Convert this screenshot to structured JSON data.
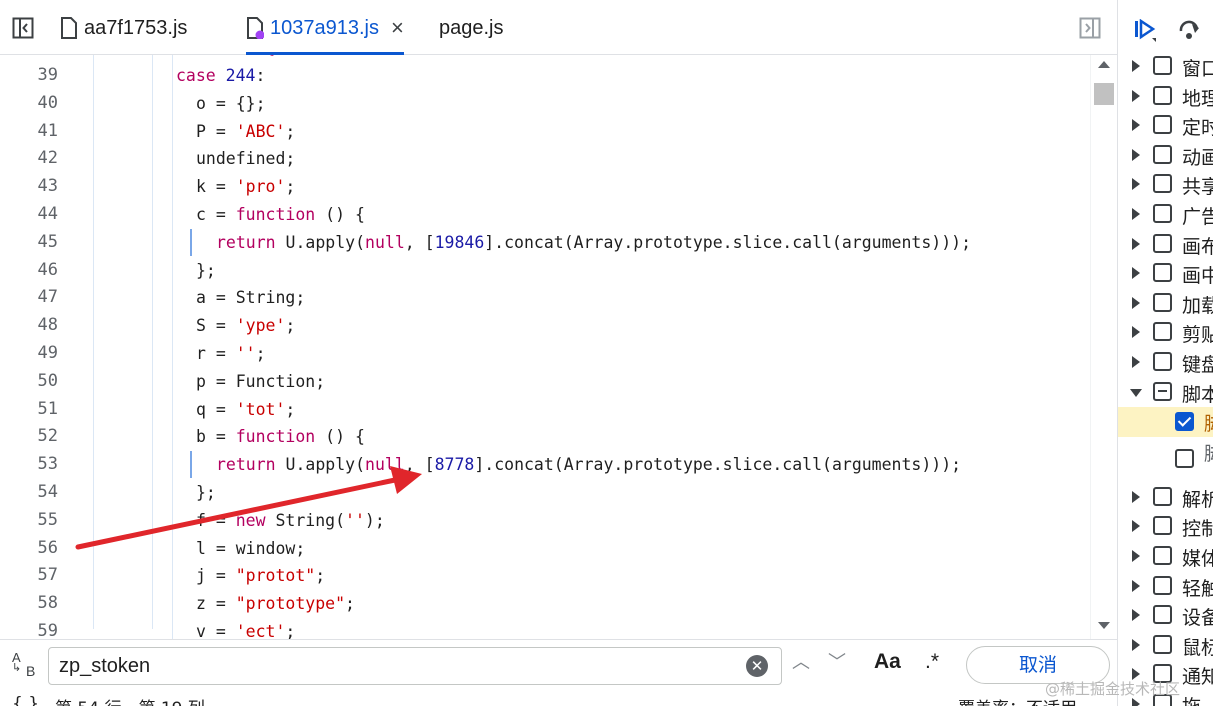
{
  "tabs": [
    {
      "label": "aa7f1753.js",
      "active": false,
      "modified": false
    },
    {
      "label": "1037a913.js",
      "active": true,
      "modified": true
    },
    {
      "label": "page.js",
      "active": false,
      "modified": false
    }
  ],
  "tab_close_glyph": "×",
  "code_top_partial": "switch (a) {",
  "code_lines": [
    {
      "n": "39",
      "indent": 1,
      "parts": [
        [
          "kw",
          "case "
        ],
        [
          "num",
          "244"
        ],
        [
          "",
          ":"
        ]
      ]
    },
    {
      "n": "40",
      "indent": 2,
      "parts": [
        [
          "",
          "o = {};"
        ]
      ]
    },
    {
      "n": "41",
      "indent": 2,
      "parts": [
        [
          "",
          "P = "
        ],
        [
          "str",
          "'ABC'"
        ],
        [
          "",
          ";"
        ]
      ]
    },
    {
      "n": "42",
      "indent": 2,
      "parts": [
        [
          "",
          "undefined;"
        ]
      ]
    },
    {
      "n": "43",
      "indent": 2,
      "parts": [
        [
          "",
          "k = "
        ],
        [
          "str",
          "'pro'"
        ],
        [
          "",
          ";"
        ]
      ]
    },
    {
      "n": "44",
      "indent": 2,
      "parts": [
        [
          "",
          "c = "
        ],
        [
          "kw",
          "function"
        ],
        [
          "",
          " () {"
        ]
      ]
    },
    {
      "n": "45",
      "indent": 3,
      "parts": [
        [
          "kw",
          "return"
        ],
        [
          "",
          " U.apply("
        ],
        [
          "kw",
          "null"
        ],
        [
          "",
          ", ["
        ],
        [
          "num",
          "19846"
        ],
        [
          "",
          "].concat(Array.prototype.slice.call(arguments)));"
        ]
      ]
    },
    {
      "n": "46",
      "indent": 2,
      "parts": [
        [
          "",
          "};"
        ]
      ]
    },
    {
      "n": "47",
      "indent": 2,
      "parts": [
        [
          "",
          "a = String;"
        ]
      ]
    },
    {
      "n": "48",
      "indent": 2,
      "parts": [
        [
          "",
          "S = "
        ],
        [
          "str",
          "'ype'"
        ],
        [
          "",
          ";"
        ]
      ]
    },
    {
      "n": "49",
      "indent": 2,
      "parts": [
        [
          "",
          "r = "
        ],
        [
          "str",
          "''"
        ],
        [
          "",
          ";"
        ]
      ]
    },
    {
      "n": "50",
      "indent": 2,
      "parts": [
        [
          "",
          "p = Function;"
        ]
      ]
    },
    {
      "n": "51",
      "indent": 2,
      "parts": [
        [
          "",
          "q = "
        ],
        [
          "str",
          "'tot'"
        ],
        [
          "",
          ";"
        ]
      ]
    },
    {
      "n": "52",
      "indent": 2,
      "parts": [
        [
          "",
          "b = "
        ],
        [
          "kw",
          "function"
        ],
        [
          "",
          " () {"
        ]
      ]
    },
    {
      "n": "53",
      "indent": 3,
      "parts": [
        [
          "kw",
          "return"
        ],
        [
          "",
          " U.apply("
        ],
        [
          "kw",
          "null"
        ],
        [
          "",
          ", ["
        ],
        [
          "num",
          "8778"
        ],
        [
          "",
          "].concat(Array.prototype.slice.call(arguments)));"
        ]
      ]
    },
    {
      "n": "54",
      "indent": 2,
      "parts": [
        [
          "",
          "};"
        ]
      ]
    },
    {
      "n": "55",
      "indent": 2,
      "parts": [
        [
          "",
          "f = "
        ],
        [
          "kw",
          "new"
        ],
        [
          "",
          " String("
        ],
        [
          "str",
          "''"
        ],
        [
          "",
          ");"
        ]
      ]
    },
    {
      "n": "56",
      "indent": 2,
      "parts": [
        [
          "",
          "l = window;"
        ]
      ]
    },
    {
      "n": "57",
      "indent": 2,
      "parts": [
        [
          "",
          "j = "
        ],
        [
          "str",
          "\"protot\""
        ],
        [
          "",
          ";"
        ]
      ]
    },
    {
      "n": "58",
      "indent": 2,
      "parts": [
        [
          "",
          "z = "
        ],
        [
          "str",
          "\"prototype\""
        ],
        [
          "",
          ";"
        ]
      ]
    },
    {
      "n": "59",
      "indent": 2,
      "parts": [
        [
          "",
          "v = "
        ],
        [
          "str",
          "'ect'"
        ],
        [
          "",
          ";"
        ]
      ]
    }
  ],
  "search": {
    "case_icon_top": "A",
    "case_icon_bottom": "B",
    "value": "zp_stoken",
    "clear_glyph": "✕",
    "prev_glyph": "︿",
    "next_glyph": "﹀",
    "match_case": "Aa",
    "regex": ".*",
    "cancel_label": "取消"
  },
  "status": {
    "braces": "{ }",
    "position": "第 54 行，第 19 列",
    "right": "覆盖率：不适用"
  },
  "breakpoints": [
    {
      "label": "窗口",
      "expanded": false,
      "state": "unchecked",
      "level": 0
    },
    {
      "label": "地理",
      "expanded": false,
      "state": "unchecked",
      "level": 0
    },
    {
      "label": "定时",
      "expanded": false,
      "state": "unchecked",
      "level": 0
    },
    {
      "label": "动画",
      "expanded": false,
      "state": "unchecked",
      "level": 0
    },
    {
      "label": "共享",
      "expanded": false,
      "state": "unchecked",
      "level": 0
    },
    {
      "label": "广告",
      "expanded": false,
      "state": "unchecked",
      "level": 0
    },
    {
      "label": "画布",
      "expanded": false,
      "state": "unchecked",
      "level": 0
    },
    {
      "label": "画中",
      "expanded": false,
      "state": "unchecked",
      "level": 0
    },
    {
      "label": "加载",
      "expanded": false,
      "state": "unchecked",
      "level": 0
    },
    {
      "label": "剪贴",
      "expanded": false,
      "state": "unchecked",
      "level": 0
    },
    {
      "label": "键盘",
      "expanded": false,
      "state": "unchecked",
      "level": 0
    },
    {
      "label": "脚本",
      "expanded": true,
      "state": "mixed",
      "level": 0
    },
    {
      "label": "脚",
      "expanded": false,
      "state": "checked",
      "level": 1
    },
    {
      "label": "脚",
      "expanded": false,
      "state": "unchecked",
      "level": 1
    },
    {
      "label": "解析",
      "expanded": false,
      "state": "unchecked",
      "level": 0
    },
    {
      "label": "控制",
      "expanded": false,
      "state": "unchecked",
      "level": 0
    },
    {
      "label": "媒体",
      "expanded": false,
      "state": "unchecked",
      "level": 0
    },
    {
      "label": "轻触",
      "expanded": false,
      "state": "unchecked",
      "level": 0
    },
    {
      "label": "设备",
      "expanded": false,
      "state": "unchecked",
      "level": 0
    },
    {
      "label": "鼠标",
      "expanded": false,
      "state": "unchecked",
      "level": 0
    },
    {
      "label": "通知",
      "expanded": false,
      "state": "unchecked",
      "level": 0
    },
    {
      "label": "拖",
      "expanded": false,
      "state": "unchecked",
      "level": 0
    }
  ],
  "watermark": "@稀土掘金技术社区",
  "colors": {
    "accent": "#0b57d0",
    "keyword": "#b3005f",
    "number": "#1a1aa6",
    "string": "#c80000",
    "highlight_row": "#fdf3c3",
    "annotation_arrow": "#e0262b"
  }
}
